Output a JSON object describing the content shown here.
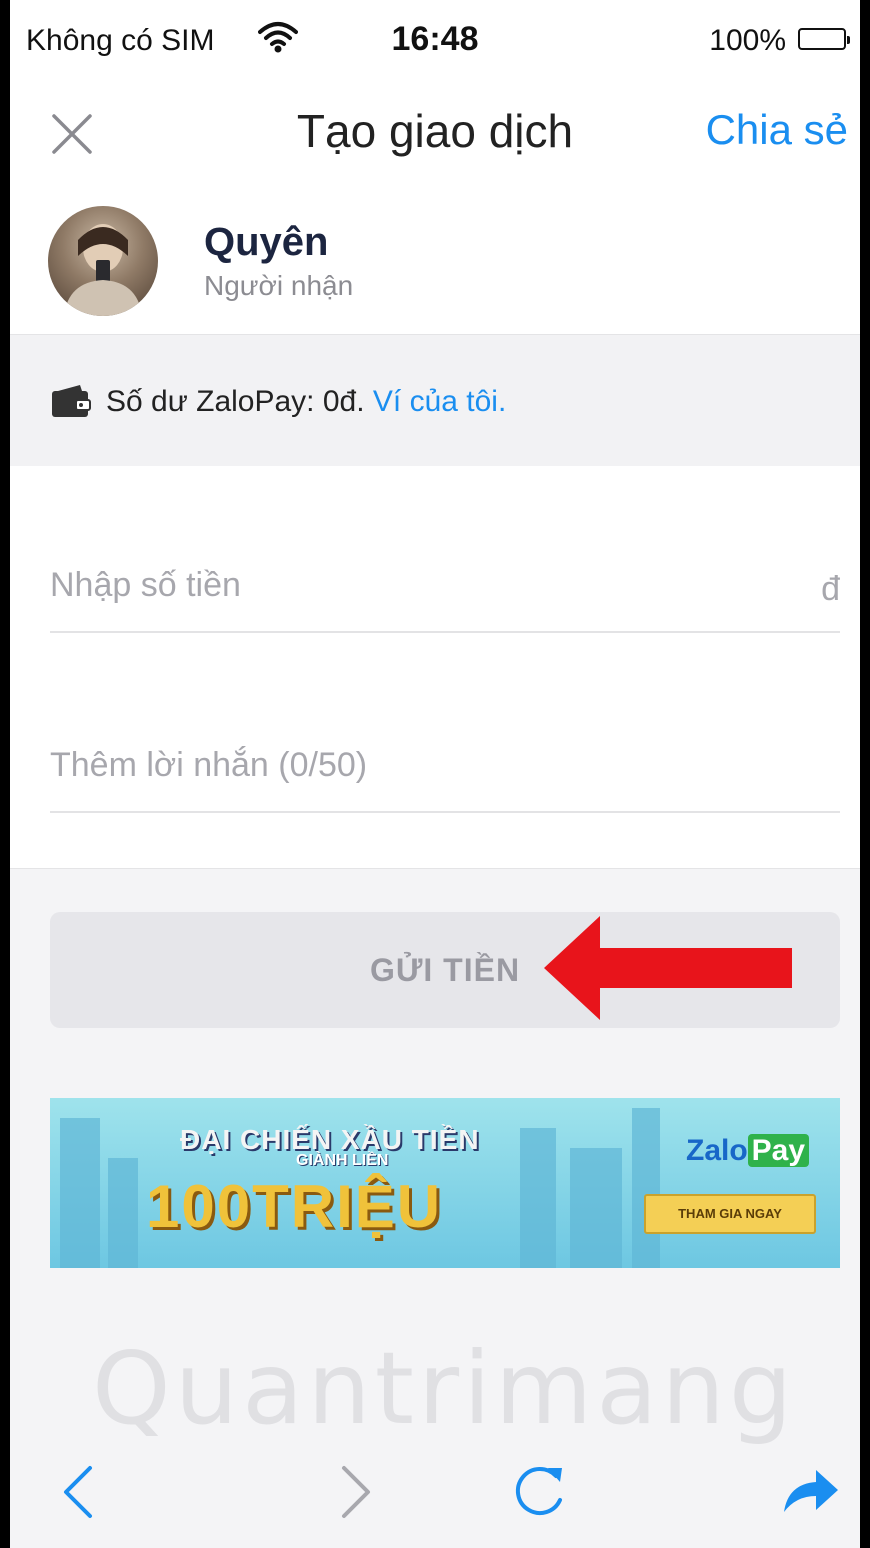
{
  "status_bar": {
    "carrier": "Không có SIM",
    "time": "16:48",
    "battery": "100%"
  },
  "nav": {
    "title": "Tạo giao dịch",
    "share": "Chia sẻ",
    "close_icon": "close-icon"
  },
  "recipient": {
    "name": "Quyên",
    "role": "Người nhận"
  },
  "balance": {
    "label": "Số dư ZaloPay: 0đ.",
    "link": "Ví của tôi."
  },
  "form": {
    "amount_placeholder": "Nhập số tiền",
    "currency": "đ",
    "note_placeholder": "Thêm lời nhắn (0/50)"
  },
  "send_button": "GỬI TIỀN",
  "banner": {
    "headline": "ĐẠI CHIẾN XẦU TIỀN",
    "sub": "GIÀNH LIỀN",
    "big": "100TRIỆU",
    "brand_zalo": "Zalo",
    "brand_pay": "Pay",
    "cta": "THAM GIA NGAY"
  },
  "watermark": "Quantrimang",
  "colors": {
    "accent": "#1a8ef0",
    "arrow": "#e8141b",
    "button_bg": "#e6e6ea"
  }
}
